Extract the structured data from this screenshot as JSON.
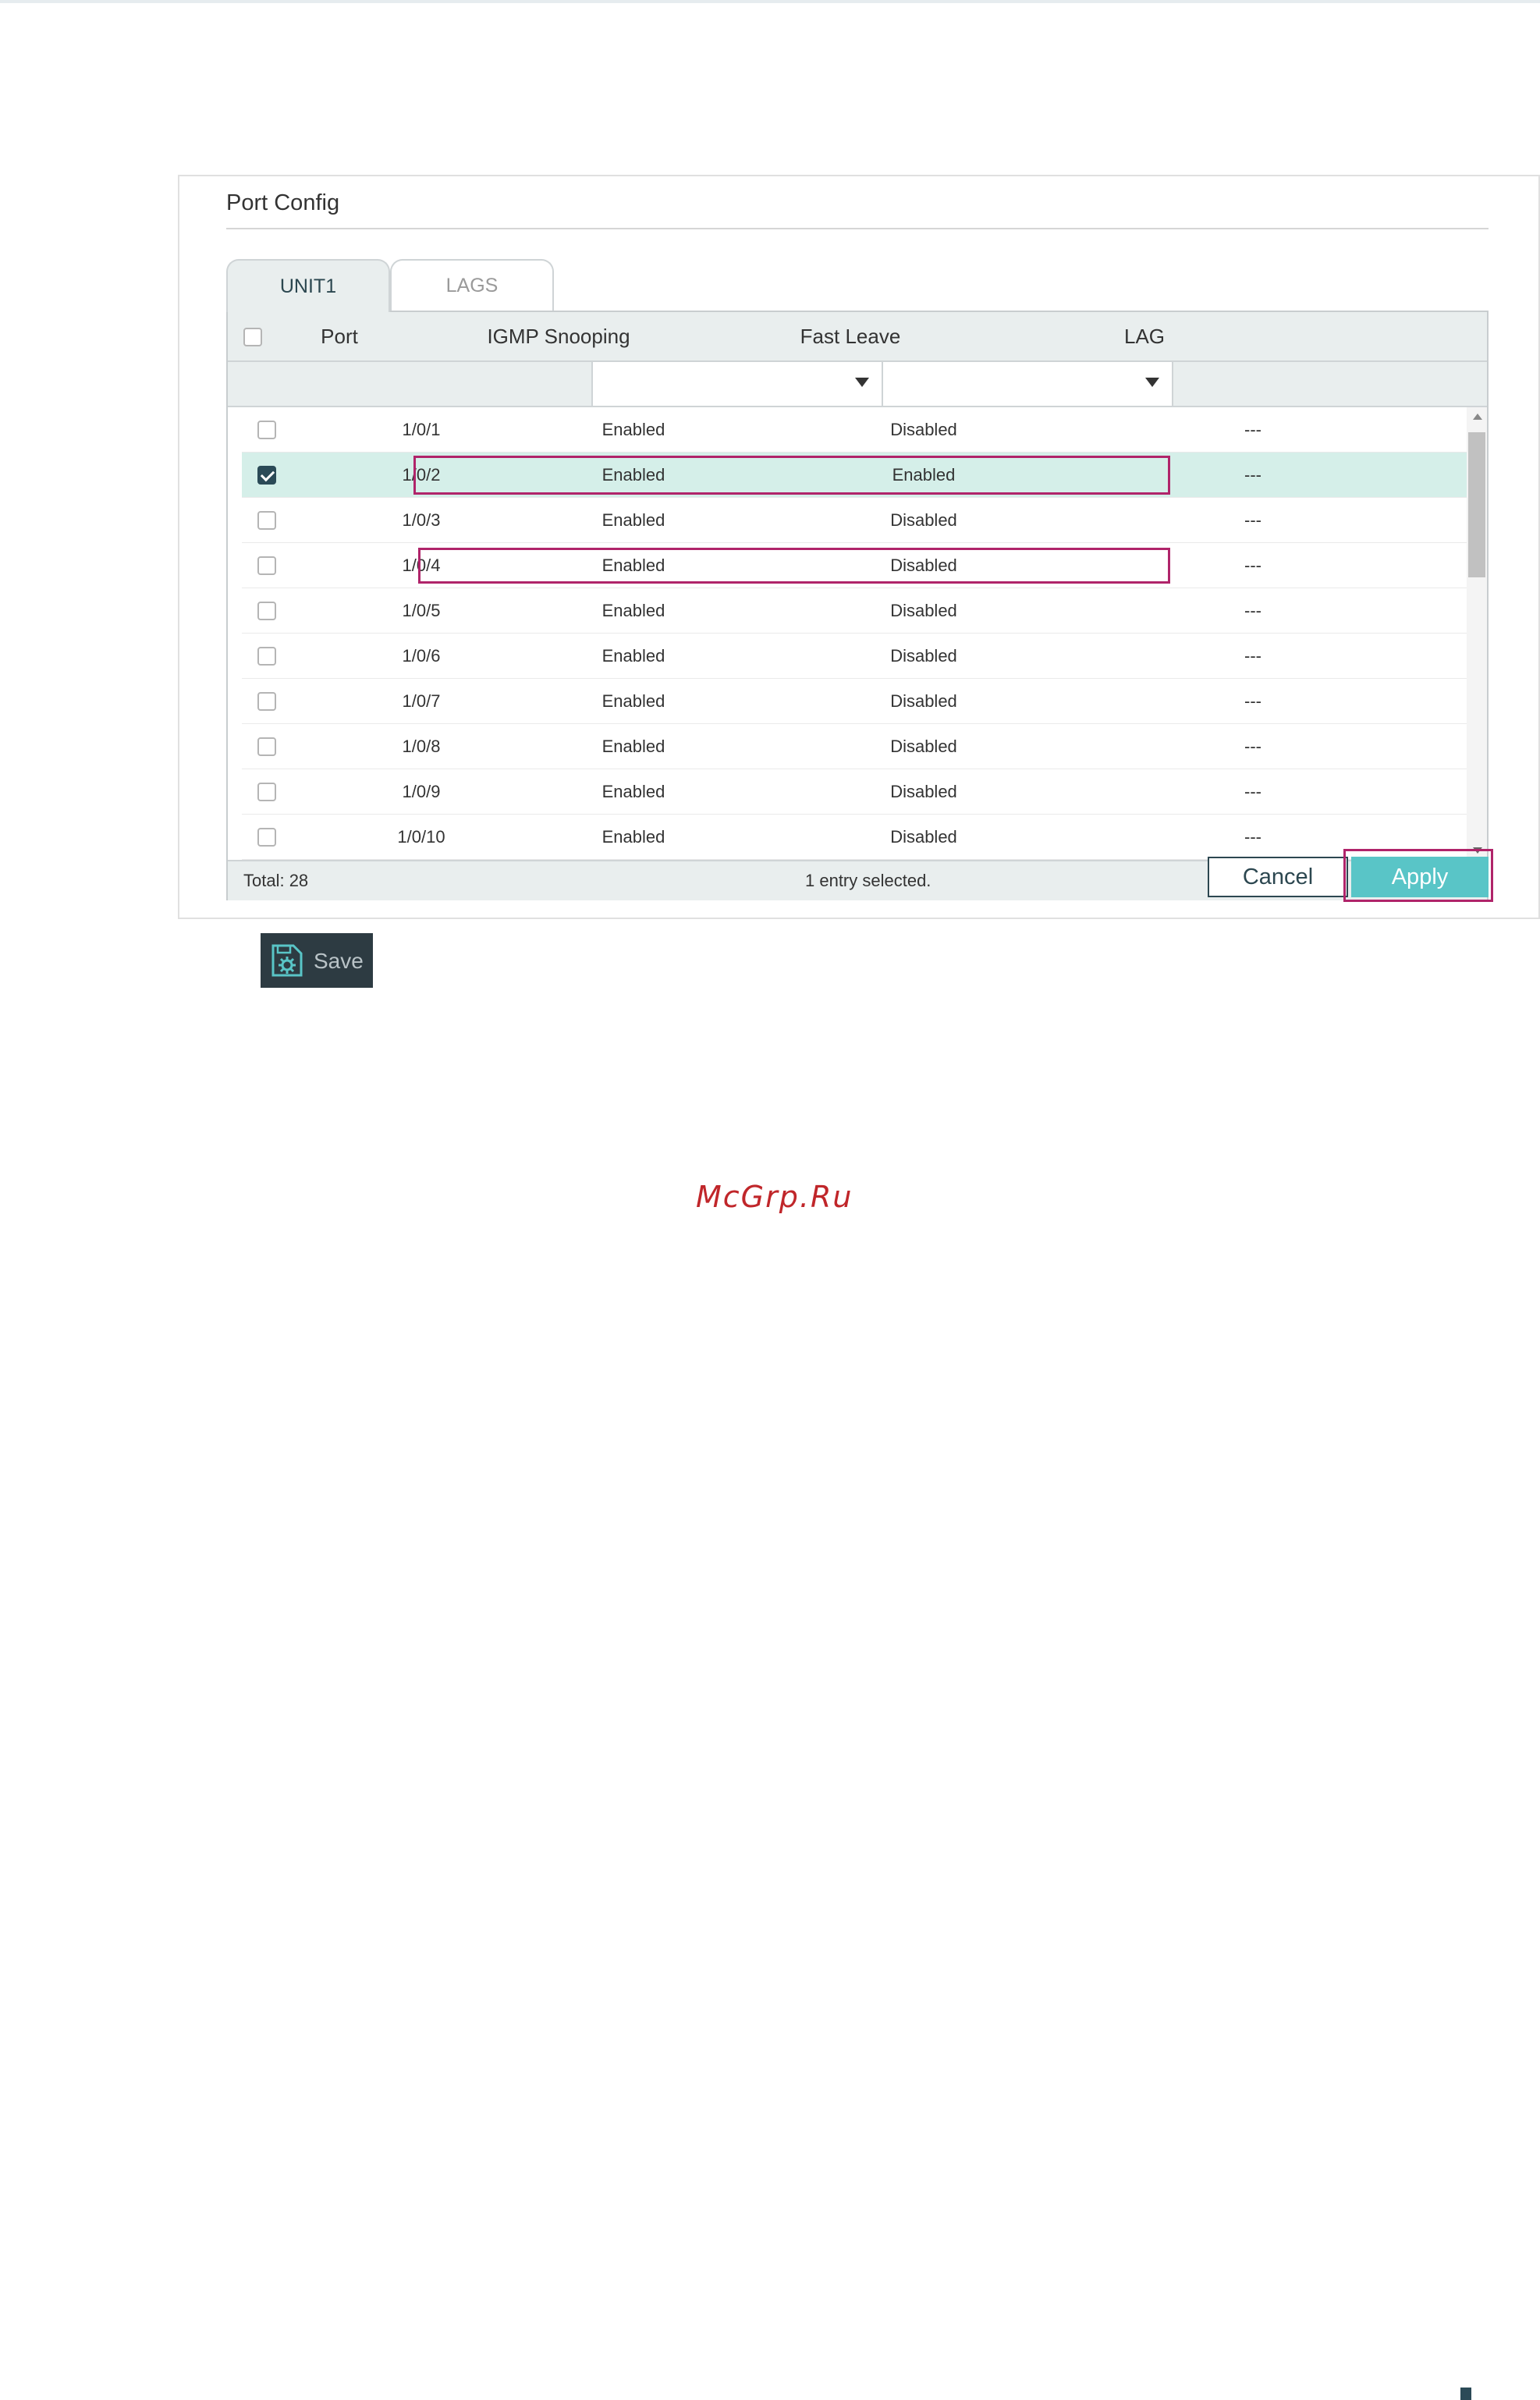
{
  "panel": {
    "title": "Port Config"
  },
  "tabs": [
    {
      "label": "UNIT1",
      "active": true
    },
    {
      "label": "LAGS",
      "active": false
    }
  ],
  "table": {
    "columns": [
      "Port",
      "IGMP Snooping",
      "Fast Leave",
      "LAG"
    ],
    "rows": [
      {
        "checked": false,
        "port": "1/0/1",
        "igmp": "Enabled",
        "fast_leave": "Disabled",
        "lag": "---"
      },
      {
        "checked": true,
        "port": "1/0/2",
        "igmp": "Enabled",
        "fast_leave": "Enabled",
        "lag": "---"
      },
      {
        "checked": false,
        "port": "1/0/3",
        "igmp": "Enabled",
        "fast_leave": "Disabled",
        "lag": "---"
      },
      {
        "checked": false,
        "port": "1/0/4",
        "igmp": "Enabled",
        "fast_leave": "Disabled",
        "lag": "---"
      },
      {
        "checked": false,
        "port": "1/0/5",
        "igmp": "Enabled",
        "fast_leave": "Disabled",
        "lag": "---"
      },
      {
        "checked": false,
        "port": "1/0/6",
        "igmp": "Enabled",
        "fast_leave": "Disabled",
        "lag": "---"
      },
      {
        "checked": false,
        "port": "1/0/7",
        "igmp": "Enabled",
        "fast_leave": "Disabled",
        "lag": "---"
      },
      {
        "checked": false,
        "port": "1/0/8",
        "igmp": "Enabled",
        "fast_leave": "Disabled",
        "lag": "---"
      },
      {
        "checked": false,
        "port": "1/0/9",
        "igmp": "Enabled",
        "fast_leave": "Disabled",
        "lag": "---"
      },
      {
        "checked": false,
        "port": "1/0/10",
        "igmp": "Enabled",
        "fast_leave": "Disabled",
        "lag": "---"
      }
    ],
    "footer": {
      "total": "Total: 28",
      "selected": "1 entry selected."
    }
  },
  "buttons": {
    "cancel": "Cancel",
    "apply": "Apply",
    "save": "Save"
  },
  "watermark": "McGrp.Ru",
  "colors": {
    "accent": "#59c5c7",
    "highlight": "#b0246a",
    "selected_row": "#d5efe9",
    "dark": "#2b4a57"
  },
  "icons": {
    "save": "save-gear-icon"
  }
}
